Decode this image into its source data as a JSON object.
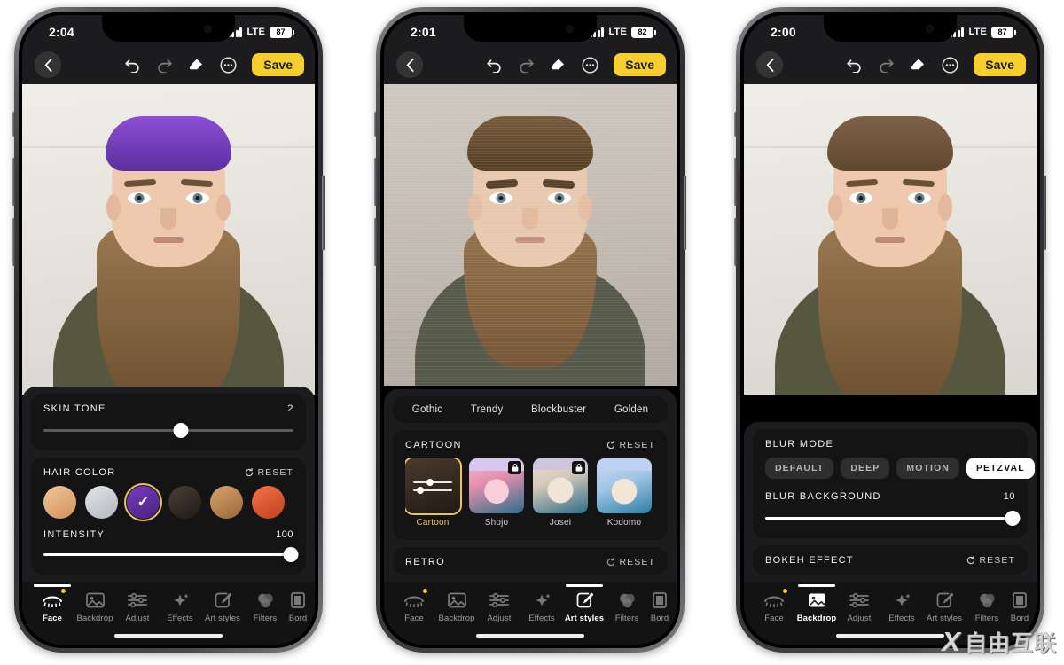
{
  "watermark": {
    "logo": "X",
    "text": "自由互联"
  },
  "phones": [
    {
      "id": "phone-face",
      "status": {
        "time": "2:04",
        "network": "LTE",
        "battery": "87"
      },
      "toolbar": {
        "back_icon": "chevron-left-icon",
        "undo_icon": "undo-icon",
        "redo_icon": "redo-icon",
        "eraser_icon": "eraser-icon",
        "more_icon": "more-circle-icon",
        "save_label": "Save"
      },
      "panel": {
        "skin_tone": {
          "label": "SKIN TONE",
          "value": "2",
          "percent": 55
        },
        "hair_color": {
          "label": "HAIR COLOR",
          "reset_label": "RESET",
          "swatches": [
            {
              "name": "blonde",
              "color": "#e2a873",
              "selected": false
            },
            {
              "name": "silver",
              "color": "#c9ccd0",
              "selected": false
            },
            {
              "name": "purple",
              "color": "#5b2b96",
              "selected": true
            },
            {
              "name": "black",
              "color": "#332b26",
              "selected": false
            },
            {
              "name": "brown",
              "color": "#c08a56",
              "selected": false
            },
            {
              "name": "red",
              "color": "#d9542b",
              "selected": false
            }
          ]
        },
        "intensity": {
          "label": "INTENSITY",
          "value": "100",
          "percent": 100
        }
      },
      "tabs": [
        {
          "label": "Face",
          "icon": "face-icon",
          "active": true,
          "badge": true
        },
        {
          "label": "Backdrop",
          "icon": "image-icon",
          "active": false,
          "badge": false
        },
        {
          "label": "Adjust",
          "icon": "sliders-icon",
          "active": false,
          "badge": false
        },
        {
          "label": "Effects",
          "icon": "sparkles-icon",
          "active": false,
          "badge": false
        },
        {
          "label": "Art styles",
          "icon": "brush-icon",
          "active": false,
          "badge": false
        },
        {
          "label": "Filters",
          "icon": "circles-icon",
          "active": false,
          "badge": false
        },
        {
          "label": "Bord",
          "icon": "border-icon",
          "active": false,
          "badge": false
        }
      ]
    },
    {
      "id": "phone-art-styles",
      "status": {
        "time": "2:01",
        "network": "LTE",
        "battery": "82"
      },
      "toolbar": {
        "back_icon": "chevron-left-icon",
        "undo_icon": "undo-icon",
        "redo_icon": "redo-icon",
        "eraser_icon": "eraser-icon",
        "more_icon": "more-circle-icon",
        "save_label": "Save"
      },
      "panel": {
        "presets": [
          "Gothic",
          "Trendy",
          "Blockbuster",
          "Golden"
        ],
        "cartoon": {
          "label": "CARTOON",
          "reset_label": "RESET",
          "items": [
            {
              "label": "Cartoon",
              "selected": true,
              "locked": false
            },
            {
              "label": "Shojo",
              "selected": false,
              "locked": true
            },
            {
              "label": "Josei",
              "selected": false,
              "locked": true
            },
            {
              "label": "Kodomo",
              "selected": false,
              "locked": false
            }
          ]
        },
        "retro": {
          "label": "RETRO",
          "reset_label": "RESET"
        }
      },
      "tabs": [
        {
          "label": "Face",
          "icon": "face-icon",
          "active": false,
          "badge": true
        },
        {
          "label": "Backdrop",
          "icon": "image-icon",
          "active": false,
          "badge": false
        },
        {
          "label": "Adjust",
          "icon": "sliders-icon",
          "active": false,
          "badge": false
        },
        {
          "label": "Effects",
          "icon": "sparkles-icon",
          "active": false,
          "badge": false
        },
        {
          "label": "Art styles",
          "icon": "brush-icon",
          "active": true,
          "badge": false
        },
        {
          "label": "Filters",
          "icon": "circles-icon",
          "active": false,
          "badge": false
        },
        {
          "label": "Bord",
          "icon": "border-icon",
          "active": false,
          "badge": false
        }
      ]
    },
    {
      "id": "phone-backdrop",
      "status": {
        "time": "2:00",
        "network": "LTE",
        "battery": "87"
      },
      "toolbar": {
        "back_icon": "chevron-left-icon",
        "undo_icon": "undo-icon",
        "redo_icon": "redo-icon",
        "eraser_icon": "eraser-icon",
        "more_icon": "more-circle-icon",
        "save_label": "Save"
      },
      "panel": {
        "blur_mode": {
          "label": "BLUR MODE",
          "options": [
            "DEFAULT",
            "DEEP",
            "MOTION",
            "PETZVAL"
          ],
          "selected": "PETZVAL"
        },
        "blur_background": {
          "label": "BLUR BACKGROUND",
          "value": "10",
          "percent": 100
        },
        "bokeh": {
          "label": "BOKEH EFFECT",
          "reset_label": "RESET"
        }
      },
      "tabs": [
        {
          "label": "Face",
          "icon": "face-icon",
          "active": false,
          "badge": true
        },
        {
          "label": "Backdrop",
          "icon": "image-icon",
          "active": true,
          "badge": false
        },
        {
          "label": "Adjust",
          "icon": "sliders-icon",
          "active": false,
          "badge": false
        },
        {
          "label": "Effects",
          "icon": "sparkles-icon",
          "active": false,
          "badge": false
        },
        {
          "label": "Art styles",
          "icon": "brush-icon",
          "active": false,
          "badge": false
        },
        {
          "label": "Filters",
          "icon": "circles-icon",
          "active": false,
          "badge": false
        },
        {
          "label": "Bord",
          "icon": "border-icon",
          "active": false,
          "badge": false
        }
      ]
    }
  ]
}
